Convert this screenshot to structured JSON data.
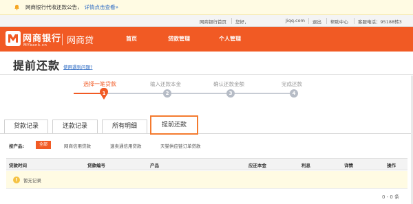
{
  "notice": {
    "text": "网商银行代收还款公告，",
    "link": "详情点击查看»"
  },
  "toplinks": {
    "home": "网商银行首页",
    "greeting": "您好，",
    "username": "Jiqq.com",
    "logout": "退出",
    "help": "帮助中心",
    "service": "客服电话：95188转3"
  },
  "header": {
    "brand_cn": "网商银行",
    "brand_en": "MYbank.cn",
    "product": "网商贷",
    "nav": [
      "首页",
      "贷款管理",
      "个人管理"
    ]
  },
  "page": {
    "title": "提前还款",
    "help_link": "使用遇到问题?"
  },
  "steps": [
    {
      "label": "选择一笔贷款",
      "num": "1",
      "active": true
    },
    {
      "label": "输入还款本金",
      "num": "2",
      "active": false
    },
    {
      "label": "确认还款金额",
      "num": "3",
      "active": false
    },
    {
      "label": "完成还款",
      "num": "4",
      "active": false
    }
  ],
  "tabs": [
    {
      "label": "贷款记录",
      "active": false
    },
    {
      "label": "还款记录",
      "active": false
    },
    {
      "label": "所有明细",
      "active": false
    },
    {
      "label": "提前还款",
      "active": true
    }
  ],
  "filter": {
    "label": "按产品:",
    "selected": "全部",
    "options": [
      "网商信用贷款",
      "速卖通信用贷款",
      "天猫供应链订单贷款"
    ]
  },
  "table": {
    "columns": [
      "贷款时间",
      "贷款编号",
      "产品",
      "应还本金",
      "利息",
      "详情",
      "操作"
    ],
    "empty_text": "暂无记录",
    "pager": "0 - 0 条"
  },
  "colors": {
    "brand": "#f15a24",
    "link": "#2d6bc4",
    "notice_bg": "#fffbe3"
  }
}
